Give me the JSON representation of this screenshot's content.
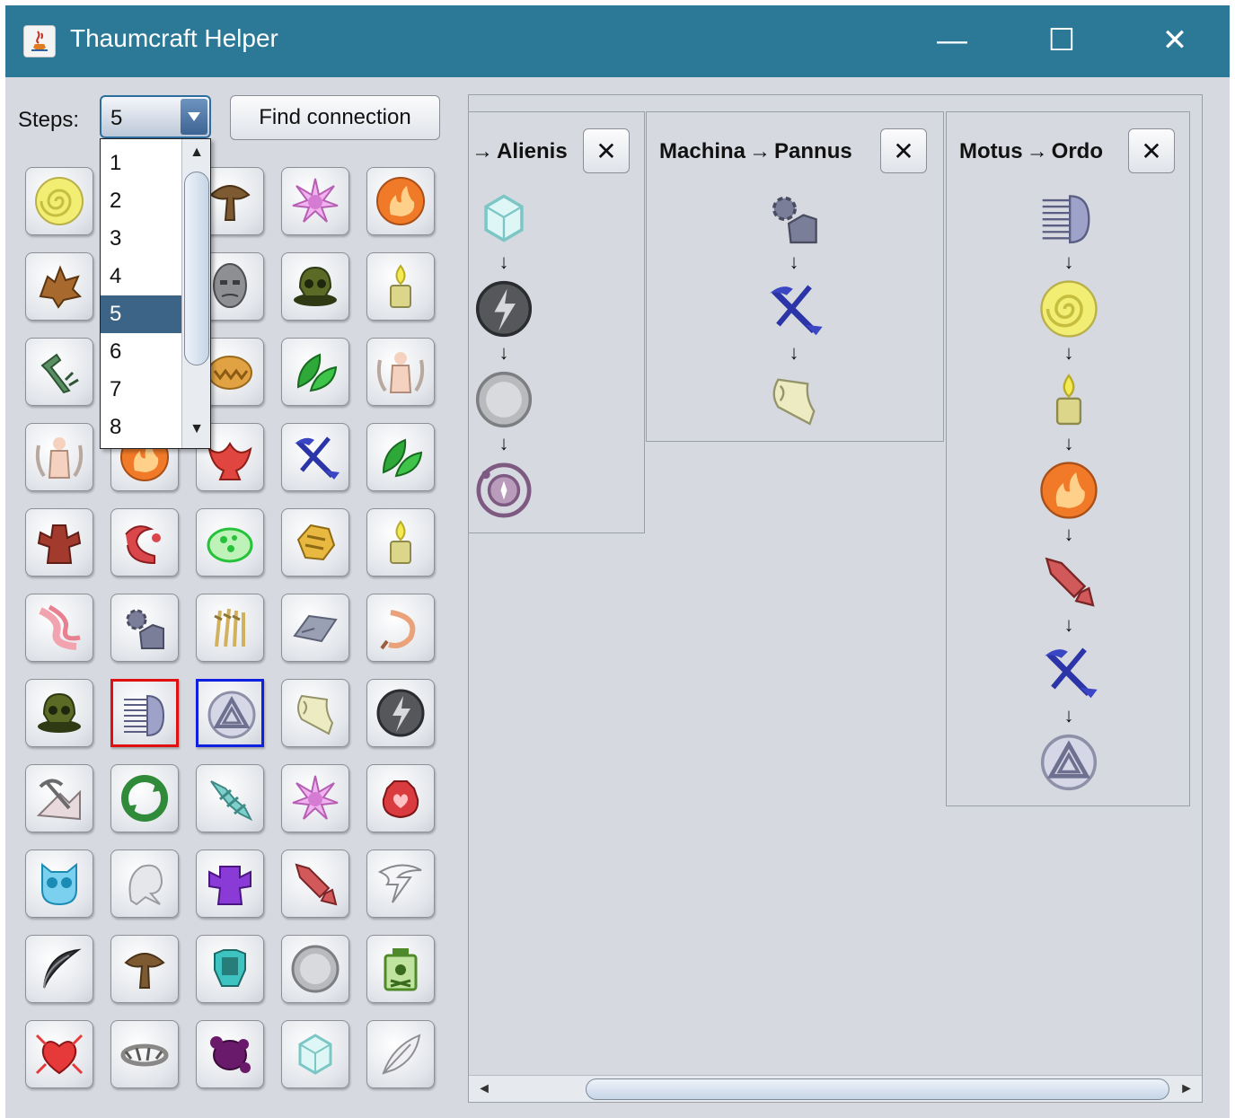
{
  "window": {
    "title": "Thaumcraft Helper",
    "minimize_glyph": "—",
    "maximize_glyph": "☐",
    "close_glyph": "✕"
  },
  "toolbar": {
    "steps_label": "Steps:",
    "steps_value": "5",
    "find_button": "Find connection"
  },
  "steps_dropdown": {
    "options": [
      "1",
      "2",
      "3",
      "4",
      "5",
      "6",
      "7",
      "8"
    ],
    "selected": "5"
  },
  "aspect_grid": {
    "rows": [
      [
        "aer-icon",
        "aqua-icon",
        "terra-icon",
        "praecantatio-icon",
        "ignis-icon"
      ],
      [
        "bestia-icon",
        "corpus-icon",
        "exanimis-icon",
        "mortuus-icon",
        "lux-icon"
      ],
      [
        "fabrico-icon",
        "vitreus-icon",
        "fames-icon",
        "herba-icon",
        "humanus-icon"
      ],
      [
        "humanus-icon",
        "ignis-icon",
        "infernus-icon",
        "instrumentum-icon",
        "herba-icon"
      ],
      [
        "ira-icon",
        "iter-icon",
        "limus-icon",
        "lucrum-icon",
        "lux-icon"
      ],
      [
        "luxuria-icon",
        "machina-icon",
        "messis-icon",
        "metallum-icon",
        "meto-icon"
      ],
      [
        "mortuus-icon",
        "motus-icon",
        "ordo-icon",
        "pannus-icon",
        "potentia-icon"
      ],
      [
        "perfodio-icon",
        "permutatio-icon",
        "pesitis-icon",
        "praecantatio-icon",
        "sano-icon"
      ],
      [
        "sensus-icon",
        "spiritus-icon",
        "superbia-icon",
        "telum-icon",
        "tempestas-icon"
      ],
      [
        "tenebrae-icon",
        "terra-icon",
        "tutamen-icon",
        "vacuos-icon",
        "venenum-icon"
      ],
      [
        "victus-icon",
        "vinculum-icon",
        "vitium-icon",
        "vitreus-icon",
        "volatus-icon"
      ]
    ],
    "selected_start": "motus-icon",
    "selected_end": "ordo-icon"
  },
  "connections": [
    {
      "from": "",
      "to": "Alienis",
      "arrow": "→",
      "close": "✕",
      "chain": [
        "vitreus-icon",
        "potentia-icon",
        "vacuos-icon",
        "alienis-icon"
      ]
    },
    {
      "from": "Machina",
      "to": "Pannus",
      "arrow": "→",
      "close": "✕",
      "chain": [
        "machina-icon",
        "instrumentum-icon",
        "pannus-icon"
      ]
    },
    {
      "from": "Motus",
      "to": "Ordo",
      "arrow": "→",
      "close": "✕",
      "chain": [
        "motus-icon",
        "aer-icon",
        "lux-icon",
        "ignis-icon",
        "telum-icon",
        "instrumentum-icon",
        "ordo-icon"
      ]
    }
  ],
  "chain_arrow": "↓",
  "scroll": {
    "left": "◄",
    "right": "►",
    "up": "▲",
    "down": "▼"
  },
  "colors": {
    "titlebar": "#2b7996",
    "window_bg": "#d6d9df",
    "selection": "#3b6486",
    "start_highlight": "#e01010",
    "end_highlight": "#1020e0"
  }
}
